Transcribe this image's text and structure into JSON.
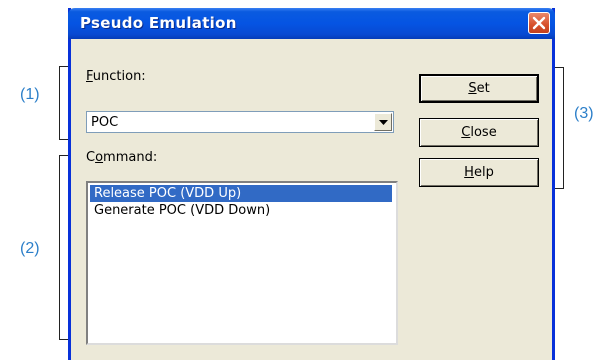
{
  "window": {
    "title": "Pseudo Emulation"
  },
  "function": {
    "label_mnemonic": "F",
    "label_rest": "unction:",
    "value": "POC"
  },
  "command": {
    "label_pre": "C",
    "label_mnemonic": "o",
    "label_rest": "mmand:",
    "items": [
      "Release POC (VDD Up)",
      "Generate POC (VDD Down)"
    ],
    "selected_index": 0
  },
  "buttons": {
    "set": {
      "mnemonic": "S",
      "rest": "et"
    },
    "close": {
      "mnemonic": "C",
      "rest": "lose"
    },
    "help": {
      "mnemonic": "H",
      "rest": "elp"
    }
  },
  "callouts": {
    "c1": "(1)",
    "c2": "(2)",
    "c3": "(3)"
  },
  "colors": {
    "callout": "#2c7fc9",
    "titlebar": "#0554e3",
    "selection": "#316ac5"
  }
}
